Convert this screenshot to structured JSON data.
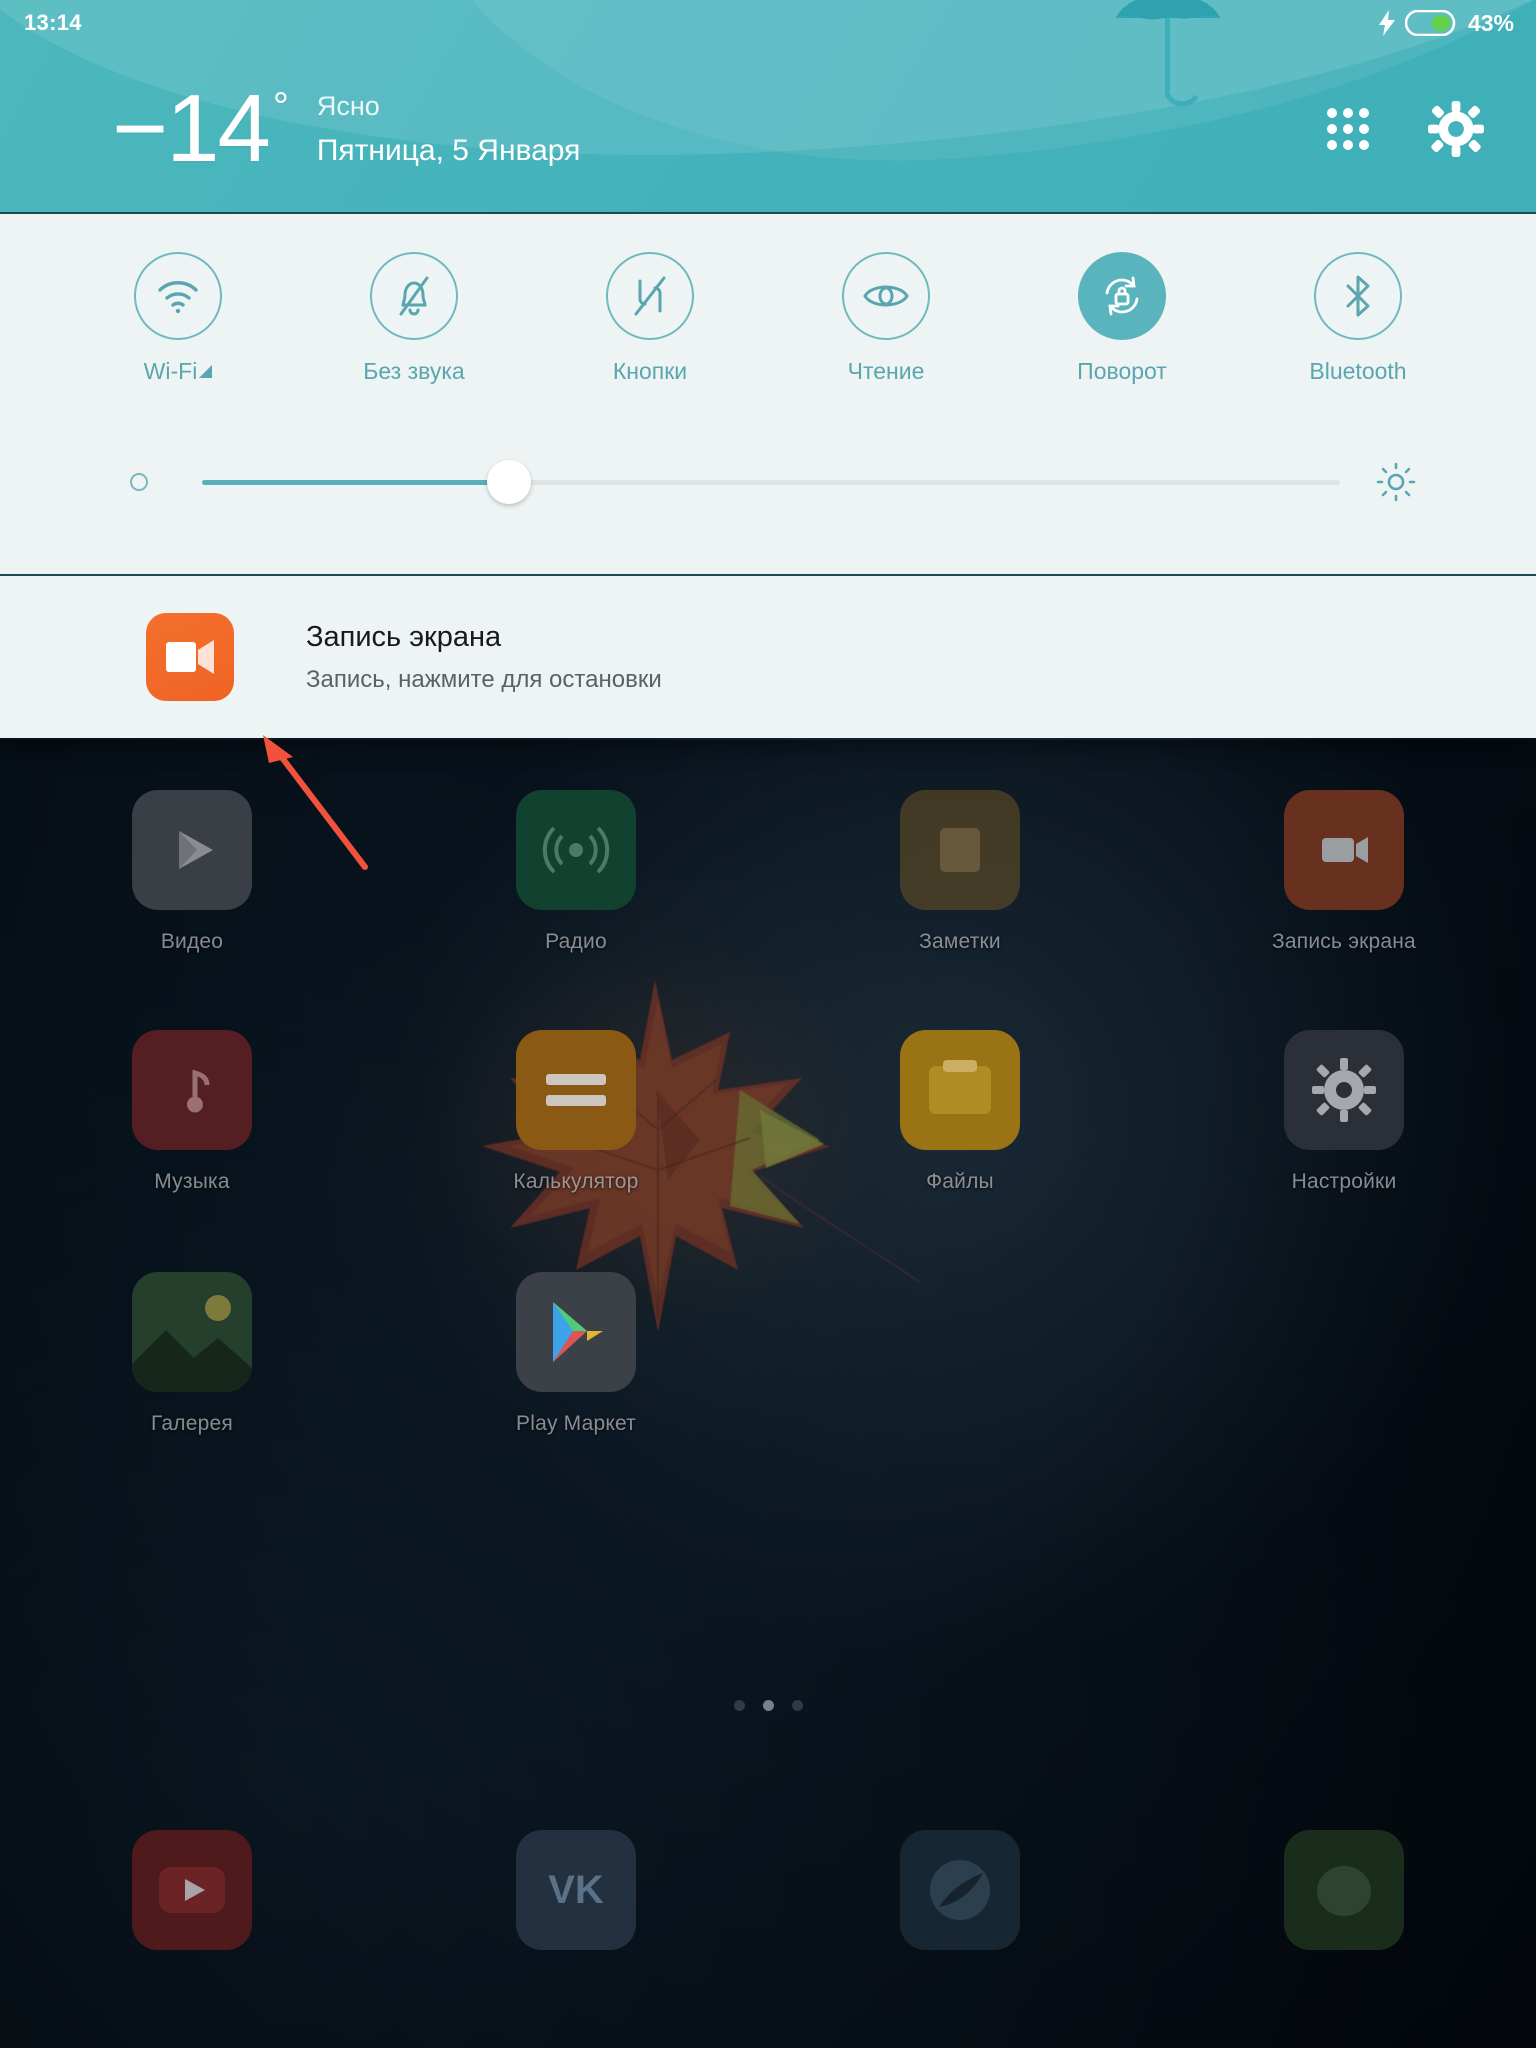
{
  "status_bar": {
    "clock": "13:14",
    "battery_percent": "43%",
    "charging_icon": "lightning-bolt-icon",
    "battery_icon": "battery-icon"
  },
  "weather": {
    "temperature": "−14",
    "degree_symbol": "°",
    "condition": "Ясно",
    "date": "Пятница, 5 Января",
    "apps_grid_icon": "apps-grid-icon",
    "settings_icon": "gear-icon",
    "accent_color": "#45b3bb"
  },
  "quick_settings": {
    "toggles": [
      {
        "label": "Wi-Fi",
        "icon": "wifi-icon",
        "active": false,
        "has_caret": true
      },
      {
        "label": "Без звука",
        "icon": "bell-muted-icon",
        "active": false,
        "has_caret": false
      },
      {
        "label": "Кнопки",
        "icon": "buttons-icon",
        "active": false,
        "has_caret": false
      },
      {
        "label": "Чтение",
        "icon": "eye-reading-icon",
        "active": false,
        "has_caret": false
      },
      {
        "label": "Поворот",
        "icon": "rotation-lock-icon",
        "active": true,
        "has_caret": false
      },
      {
        "label": "Bluetooth",
        "icon": "bluetooth-icon",
        "active": false,
        "has_caret": false
      }
    ],
    "brightness": {
      "value_percent": 27,
      "low_icon": "brightness-low-icon",
      "high_icon": "brightness-high-sun-icon"
    },
    "toggle_color": "#5aa6b0",
    "active_color": "#5ab4bd"
  },
  "notification": {
    "title": "Запись экрана",
    "subtitle": "Запись, нажмите для остановки",
    "icon": "screen-record-camera-icon",
    "icon_color": "#ef6325"
  },
  "home_screen": {
    "rows": [
      [
        {
          "label": "Видео",
          "icon": "play-video-icon"
        },
        {
          "label": "Радио",
          "icon": "radio-signal-icon"
        },
        {
          "label": "Заметки",
          "icon": "notes-icon"
        },
        {
          "label": "Запись экрана",
          "icon": "screen-record-camera-icon"
        }
      ],
      [
        {
          "label": "Музыка",
          "icon": "music-note-icon"
        },
        {
          "label": "Калькулятор",
          "icon": "calculator-equals-icon"
        },
        {
          "label": "Файлы",
          "icon": "folder-files-icon"
        },
        {
          "label": "Настройки",
          "icon": "gear-icon"
        }
      ],
      [
        {
          "label": "Галерея",
          "icon": "gallery-photo-icon"
        },
        {
          "label": "Play Маркет",
          "icon": "play-store-icon"
        }
      ]
    ],
    "dock": [
      {
        "label": "",
        "icon": "youtube-icon"
      },
      {
        "label": "",
        "icon": "vk-icon"
      },
      {
        "label": "",
        "icon": "browser-icon"
      },
      {
        "label": "",
        "icon": "app-icon"
      }
    ],
    "page_dots": {
      "count": 3,
      "active_index": 1
    }
  },
  "annotation": {
    "arrow_color": "#f2523c",
    "arrow": "red-arrow-pointing-up-left"
  }
}
